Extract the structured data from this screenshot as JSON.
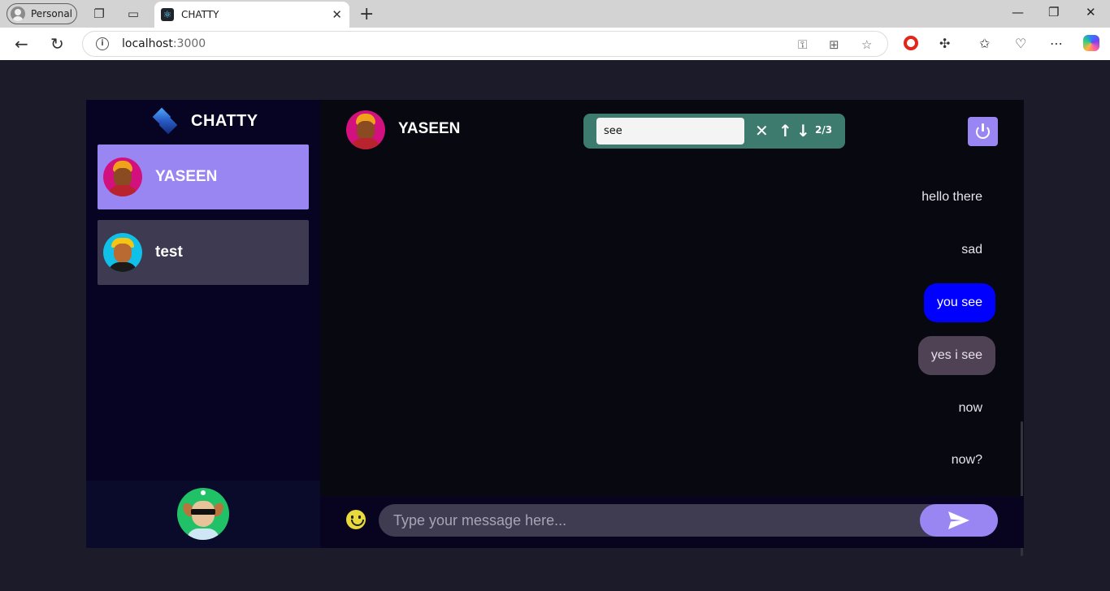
{
  "browser": {
    "profile_label": "Personal",
    "tab_title": "CHATTY",
    "url_host": "localhost",
    "url_port": ":3000"
  },
  "app": {
    "brand": "CHATTY",
    "contacts": [
      {
        "name": "YASEEN",
        "selected": true
      },
      {
        "name": "test",
        "selected": false
      }
    ],
    "chat": {
      "title": "YASEEN",
      "search": {
        "value": "see",
        "match_counter": "2/3"
      },
      "messages": [
        {
          "text": "hello there",
          "highlight": "none"
        },
        {
          "text": "sad",
          "highlight": "none"
        },
        {
          "text": "you see",
          "highlight": "current-match"
        },
        {
          "text": "yes i see",
          "highlight": "match"
        },
        {
          "text": "now",
          "highlight": "none"
        },
        {
          "text": "now?",
          "highlight": "none"
        }
      ],
      "input_placeholder": "Type your message here..."
    }
  },
  "colors": {
    "accent": "#9a86f3",
    "search_bar": "#3d7b6f",
    "current_match": "#0000ff",
    "match": "#4f4255"
  }
}
